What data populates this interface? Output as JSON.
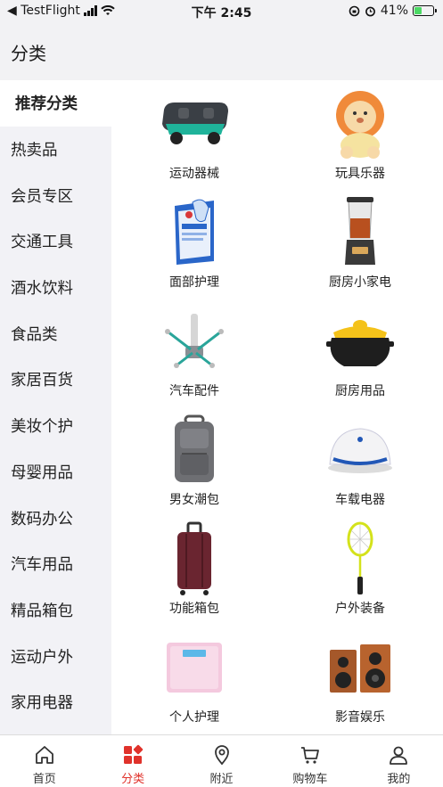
{
  "status_bar": {
    "back_app": "◀ TestFlight",
    "time": "下午 2:45",
    "battery_percent": "41%",
    "battery_level": 0.41,
    "battery_color": "#4cd964"
  },
  "header": {
    "title": "分类"
  },
  "sidebar": {
    "items": [
      {
        "label": "推荐分类",
        "active": true
      },
      {
        "label": "热卖品"
      },
      {
        "label": "会员专区"
      },
      {
        "label": "交通工具"
      },
      {
        "label": "酒水饮料"
      },
      {
        "label": "食品类"
      },
      {
        "label": "家居百货"
      },
      {
        "label": "美妆个护"
      },
      {
        "label": "母婴用品"
      },
      {
        "label": "数码办公"
      },
      {
        "label": "汽车用品"
      },
      {
        "label": "精品箱包"
      },
      {
        "label": "运动户外"
      },
      {
        "label": "家用电器"
      }
    ]
  },
  "categories": [
    {
      "label": "运动器械",
      "icon": "balance-board-icon"
    },
    {
      "label": "玩具乐器",
      "icon": "lion-toy-icon"
    },
    {
      "label": "面部护理",
      "icon": "face-mask-icon"
    },
    {
      "label": "厨房小家电",
      "icon": "blender-icon"
    },
    {
      "label": "汽车配件",
      "icon": "car-charger-icon"
    },
    {
      "label": "厨房用品",
      "icon": "clay-pot-icon"
    },
    {
      "label": "男女潮包",
      "icon": "backpack-icon"
    },
    {
      "label": "车载电器",
      "icon": "car-purifier-icon"
    },
    {
      "label": "功能箱包",
      "icon": "suitcase-icon"
    },
    {
      "label": "户外装备",
      "icon": "badminton-racket-icon"
    },
    {
      "label": "个人护理",
      "icon": "bathroom-scale-icon"
    },
    {
      "label": "影音娱乐",
      "icon": "speakers-icon"
    }
  ],
  "tabbar": {
    "tabs": [
      {
        "label": "首页",
        "icon": "home-icon"
      },
      {
        "label": "分类",
        "icon": "category-icon",
        "active": true
      },
      {
        "label": "附近",
        "icon": "location-pin-icon"
      },
      {
        "label": "购物车",
        "icon": "cart-icon"
      },
      {
        "label": "我的",
        "icon": "user-icon"
      }
    ],
    "active_color": "#e0322b"
  }
}
